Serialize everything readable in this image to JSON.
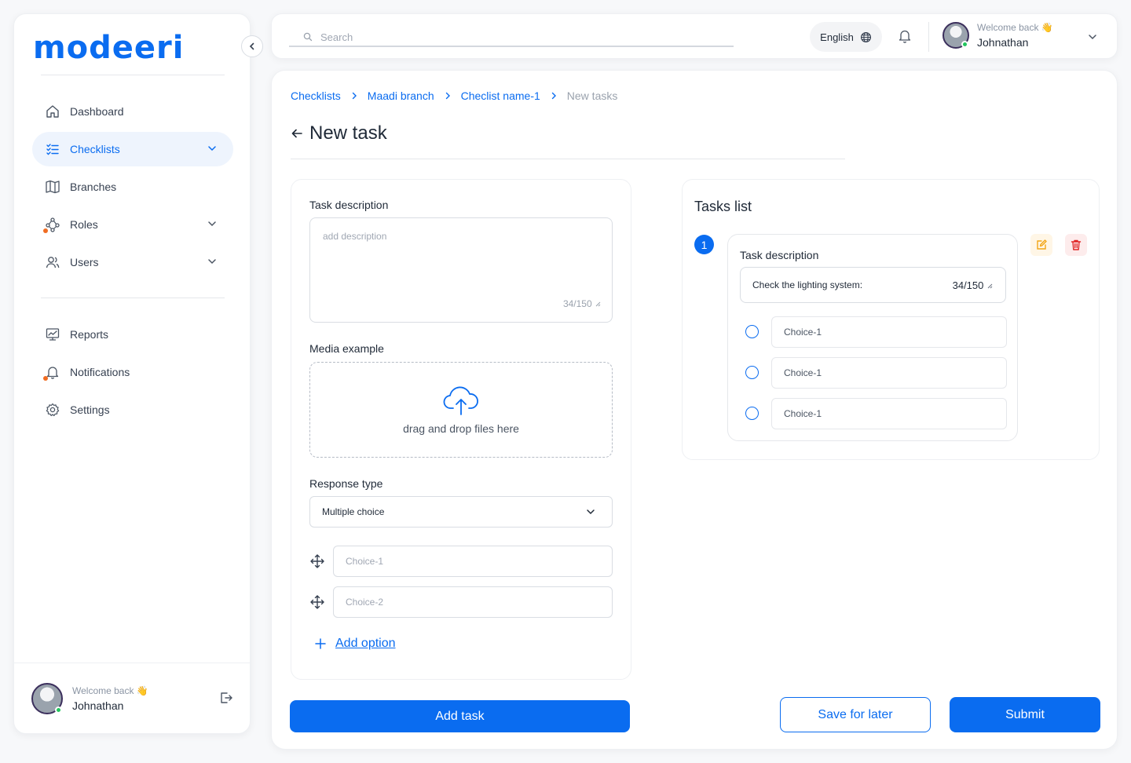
{
  "brand": {
    "logo_text": "modeeri"
  },
  "sidebar": {
    "items": [
      {
        "label": "Dashboard"
      },
      {
        "label": "Checklists"
      },
      {
        "label": "Branches"
      },
      {
        "label": "Roles"
      },
      {
        "label": "Users"
      },
      {
        "label": "Reports"
      },
      {
        "label": "Notifications"
      },
      {
        "label": "Settings"
      }
    ],
    "active": "Checklists",
    "user": {
      "welcome": "Welcome back 👋",
      "name": "Johnathan"
    }
  },
  "topbar": {
    "search_placeholder": "Search",
    "language": "English",
    "user": {
      "welcome": "Welcome back 👋",
      "name": "Johnathan"
    }
  },
  "breadcrumb": [
    "Checklists",
    "Maadi branch",
    "Checlist name-1",
    "New tasks"
  ],
  "page_title": "New task",
  "form": {
    "task_description_label": "Task description",
    "task_description_placeholder": "add description",
    "counter": "34/150",
    "media_label": "Media example",
    "dropzone_text": "drag and drop files here",
    "response_type_label": "Response type",
    "response_type_value": "Multiple choice",
    "choices": [
      {
        "placeholder": "Choice-1"
      },
      {
        "placeholder": "Choice-2"
      }
    ],
    "add_option_label": "Add option"
  },
  "tasks_list": {
    "title": "Tasks list",
    "items": [
      {
        "number": "1",
        "label": "Task description",
        "description": "Check the lighting system:",
        "counter": "34/150",
        "options": [
          "Choice-1",
          "Choice-1",
          "Choice-1"
        ]
      }
    ]
  },
  "actions": {
    "add_task": "Add task",
    "save_for_later": "Save for later",
    "submit": "Submit"
  },
  "colors": {
    "primary": "#0a6cf0",
    "brand_accent": "#12c48b",
    "notification_dot": "#f06c22",
    "online": "#22c55e",
    "edit_icon": "#f2a516",
    "delete_icon": "#e02424"
  }
}
